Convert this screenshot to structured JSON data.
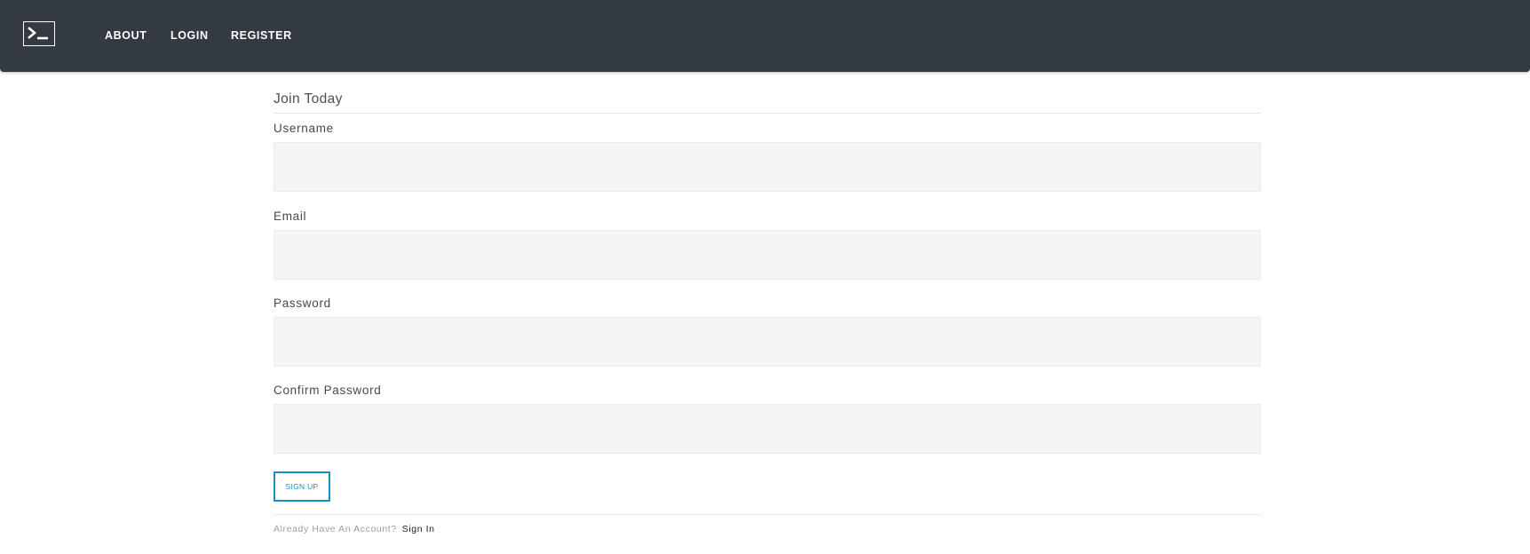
{
  "nav": {
    "logo_icon": "terminal-icon",
    "links": [
      {
        "label": "ABOUT"
      },
      {
        "label": "LOGIN"
      },
      {
        "label": "REGISTER"
      }
    ],
    "background_color": "#343a42"
  },
  "form": {
    "legend": "Join Today",
    "fields": {
      "username": {
        "label": "Username",
        "value": "",
        "placeholder": ""
      },
      "email": {
        "label": "Email",
        "value": "",
        "placeholder": ""
      },
      "password": {
        "label": "Password",
        "value": "",
        "placeholder": ""
      },
      "confirm_password": {
        "label": "Confirm Password",
        "value": "",
        "placeholder": ""
      }
    },
    "submit_label": "SIGN UP",
    "accent_color": "#1a8fc4"
  },
  "footer": {
    "prompt": "Already Have An Account?",
    "link_label": "Sign In"
  }
}
